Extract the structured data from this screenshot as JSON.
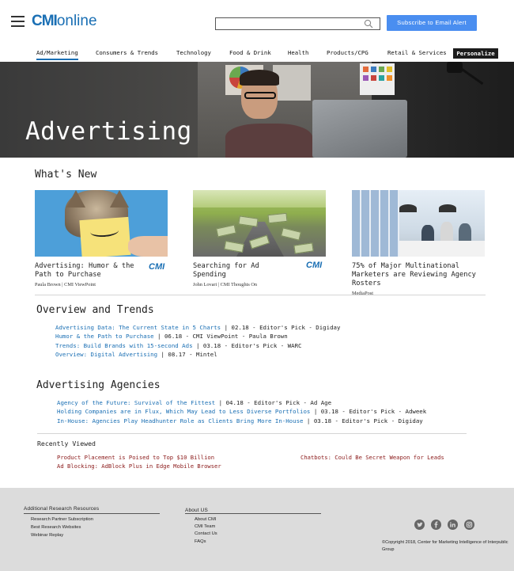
{
  "brand": {
    "logo_strong": "CMI",
    "logo_light": "online",
    "accent": "#1a6fb4"
  },
  "header": {
    "search_placeholder": "",
    "subscribe_label": "Subscribe to Email Alert"
  },
  "nav": {
    "items": [
      {
        "label": "Ad/Marketing",
        "active": true
      },
      {
        "label": "Consumers & Trends"
      },
      {
        "label": "Technology"
      },
      {
        "label": "Food & Drink"
      },
      {
        "label": "Health"
      },
      {
        "label": "Products/CPG"
      },
      {
        "label": "Retail & Services"
      }
    ],
    "personalize_label": "Personalize"
  },
  "hero": {
    "title": "Advertising"
  },
  "whats_new": {
    "title": "What's New",
    "cards": [
      {
        "headline": "Advertising: Humor & the Path to Purchase",
        "byline": "Paula Brown | CMI ViewPoint",
        "badge": "CMI"
      },
      {
        "headline": "Searching for Ad Spending",
        "byline": "John Lovari | CMI Thoughts On",
        "badge": "CMI"
      },
      {
        "headline": "75% of Major Multinational Marketers are Reviewing Agency Rosters",
        "byline": "MediaPost"
      }
    ]
  },
  "overview": {
    "title": "Overview and Trends",
    "rows": [
      {
        "link": "Advertising Data: The Current State in 5 Charts",
        "meta": " | 02.18 - Editor's Pick - Digiday"
      },
      {
        "link": "Humor & the Path to Purchase",
        "meta": " | 06.18 - CMI ViewPoint - Paula Brown"
      },
      {
        "link": "Trends: Build Brands with 15-second Ads",
        "meta": " | 03.18 - Editor's Pick - WARC"
      },
      {
        "link": "Overview: Digital Advertising",
        "meta": " | 08.17 - Mintel"
      }
    ]
  },
  "agencies": {
    "title": "Advertising Agencies",
    "rows": [
      {
        "link": "Agency of the Future: Survival of the Fittest",
        "meta": " | 04.18 - Editor's Pick - Ad Age"
      },
      {
        "link": "Holding Companies are in Flux, Which May Lead to Less Diverse Portfolios",
        "meta": " | 03.18 - Editor's Pick - Adweek"
      },
      {
        "link": "In-House: Agencies Play Headhunter Role as Clients Bring More In-House",
        "meta": " | 03.18 - Editor's Pick - Digiday"
      }
    ]
  },
  "recently_viewed": {
    "title": "Recently Viewed",
    "items": [
      "Product Placement is Poised to Top $10 Billion",
      "Ad Blocking: AdBlock Plus in Edge Mobile Browser",
      "Chatbots: Could Be Secret Weapon for Leads"
    ]
  },
  "footer": {
    "research_title": "Additional Research Resources",
    "research_links": [
      "Research Partner Subscription",
      "Best Research Websites",
      "Webinar Replay"
    ],
    "about_title": "About US",
    "about_links": [
      "About CMI",
      "CMI Team",
      "Contact Us",
      "FAQs"
    ],
    "social_icons": [
      "twitter-icon",
      "facebook-icon",
      "linkedin-icon",
      "instagram-icon"
    ],
    "copyright": "©Copyright 2018, Center for Marketing Intelligence of Interpublic Group"
  }
}
